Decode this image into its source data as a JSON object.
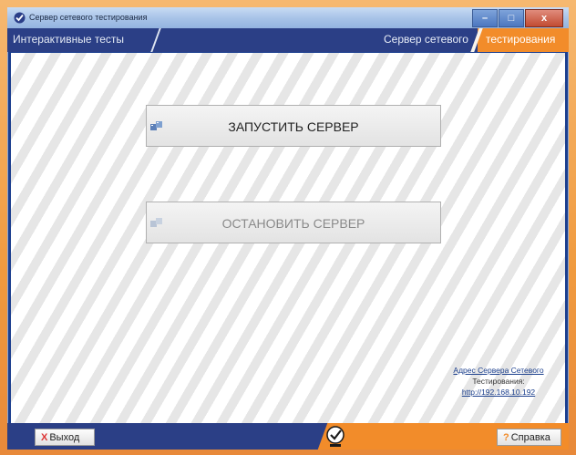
{
  "window": {
    "title": "Сервер сетевого тестирования"
  },
  "header": {
    "left_tab": "Интерактивные тесты",
    "right_part1": "Сервер сетевого",
    "right_part2": "тестирования"
  },
  "main": {
    "start_button": "ЗАПУСТИТЬ СЕРВЕР",
    "stop_button": "ОСТАНОВИТЬ СЕРВЕР",
    "start_enabled": true,
    "stop_enabled": false
  },
  "address": {
    "line1": "Адрес Сервера Сетевого",
    "line2": "Тестирования:",
    "url": "http://192.168.10.192"
  },
  "footer": {
    "exit_label": "Выход",
    "help_label": "Справка"
  },
  "colors": {
    "navy": "#2b3f86",
    "orange": "#f28c2a",
    "accent_link": "#1a3e8c"
  },
  "icons": {
    "title": "check-logo-icon",
    "start": "server-icon",
    "stop": "server-icon",
    "exit": "close-x-icon",
    "help": "question-icon",
    "logo": "check-logo-icon"
  }
}
